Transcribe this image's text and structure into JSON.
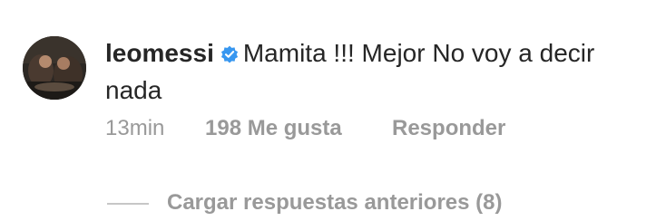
{
  "comment": {
    "username": "leomessi",
    "text": "Mamita !!! Mejor No voy a decir nada",
    "time": "13min",
    "likes": "198 Me gusta",
    "reply_label": "Responder",
    "load_replies_label": "Cargar respuestas anteriores (8)",
    "verified_icon": "verified-badge-icon",
    "colors": {
      "text": "#262626",
      "meta": "#999999",
      "verified": "#3897f0"
    }
  }
}
